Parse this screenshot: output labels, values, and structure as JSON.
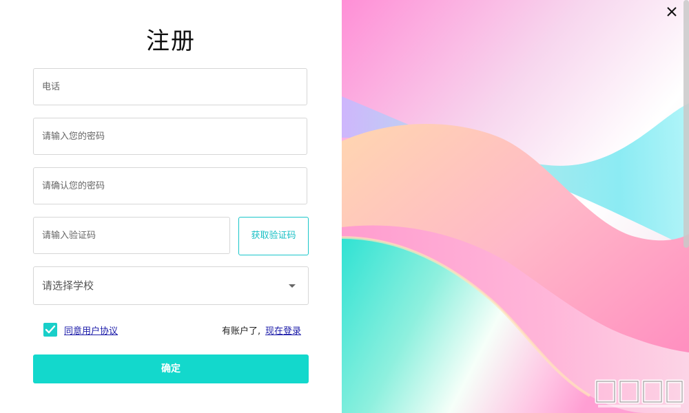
{
  "form": {
    "title": "注册",
    "phone_placeholder": "电话",
    "password_placeholder": "请输入您的密码",
    "confirm_password_placeholder": "请确认您的密码",
    "code_placeholder": "请输入验证码",
    "get_code_label": "获取验证码",
    "school_select_value": "请选择学校",
    "agree_checked": true,
    "agree_link_label": "同意用户协议",
    "has_account_text": "有账户了,",
    "login_link_label": "现在登录",
    "submit_label": "确定"
  },
  "window": {
    "close_icon": "close-icon"
  },
  "colors": {
    "accent": "#13d8cc",
    "link": "#1a1aa8",
    "border": "#d6d6d6"
  }
}
